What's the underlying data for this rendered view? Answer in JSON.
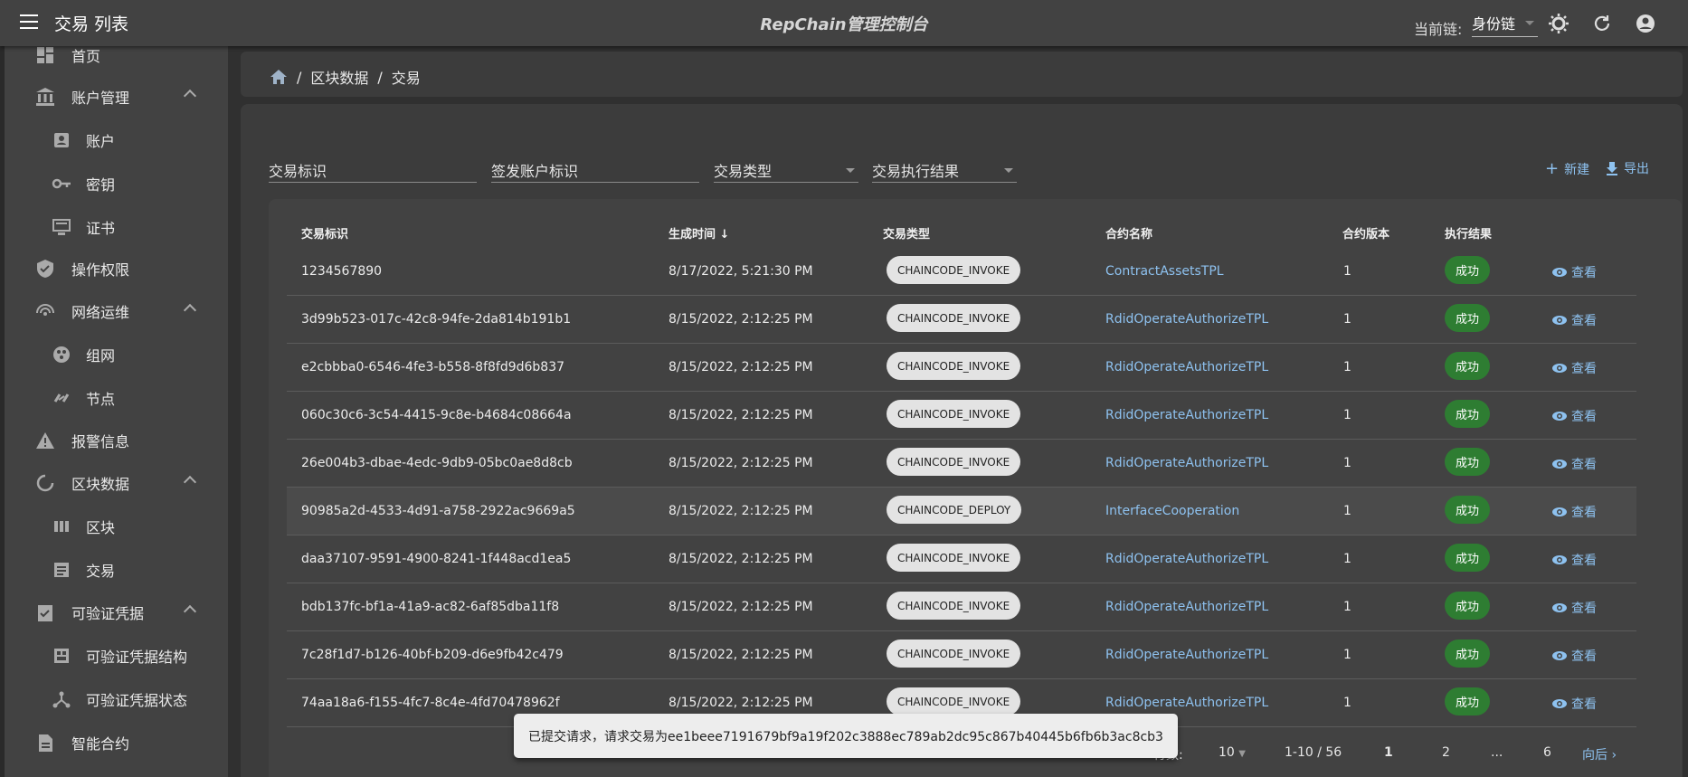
{
  "appbar": {
    "title": "交易 列表",
    "center_title": "RepChain管理控制台",
    "chain_label": "当前链:",
    "chain_value": "身份链"
  },
  "sidebar": {
    "items": [
      {
        "label": "首页",
        "icon": "dashboard-icon"
      },
      {
        "label": "账户管理",
        "icon": "bank-icon"
      },
      {
        "label": "账户",
        "icon": "account-box-icon"
      },
      {
        "label": "密钥",
        "icon": "key-icon"
      },
      {
        "label": "证书",
        "icon": "certificate-icon"
      },
      {
        "label": "操作权限",
        "icon": "shield-check-icon"
      },
      {
        "label": "网络运维",
        "icon": "wifi-icon"
      },
      {
        "label": "组网",
        "icon": "hub-icon"
      },
      {
        "label": "节点",
        "icon": "link-node-icon"
      },
      {
        "label": "报警信息",
        "icon": "warning-icon"
      },
      {
        "label": "区块数据",
        "icon": "loop-icon"
      },
      {
        "label": "区块",
        "icon": "blocks-icon"
      },
      {
        "label": "交易",
        "icon": "list-icon"
      },
      {
        "label": "可验证凭据",
        "icon": "clipboard-check-icon"
      },
      {
        "label": "可验证凭据结构",
        "icon": "schema-icon"
      },
      {
        "label": "可验证凭据状态",
        "icon": "tree-icon"
      },
      {
        "label": "智能合约",
        "icon": "document-icon"
      }
    ]
  },
  "breadcrumb": {
    "items": [
      "区块数据",
      "交易"
    ]
  },
  "filters": {
    "tx_id": "交易标识",
    "signer_id": "签发账户标识",
    "tx_type": "交易类型",
    "tx_result": "交易执行结果"
  },
  "actions": {
    "new_label": "新建",
    "export_label": "导出"
  },
  "table": {
    "headers": [
      "交易标识",
      "生成时间",
      "交易类型",
      "合约名称",
      "合约版本",
      "执行结果"
    ],
    "view_label": "查看",
    "rows": [
      {
        "id": "1234567890",
        "time": "8/17/2022, 5:21:30 PM",
        "type": "CHAINCODE_INVOKE",
        "contract": "ContractAssetsTPL",
        "version": "1",
        "result": "成功"
      },
      {
        "id": "3d99b523-017c-42c8-94fe-2da814b191b1",
        "time": "8/15/2022, 2:12:25 PM",
        "type": "CHAINCODE_INVOKE",
        "contract": "RdidOperateAuthorizeTPL",
        "version": "1",
        "result": "成功"
      },
      {
        "id": "e2cbbba0-6546-4fe3-b558-8f8fd9d6b837",
        "time": "8/15/2022, 2:12:25 PM",
        "type": "CHAINCODE_INVOKE",
        "contract": "RdidOperateAuthorizeTPL",
        "version": "1",
        "result": "成功"
      },
      {
        "id": "060c30c6-3c54-4415-9c8e-b4684c08664a",
        "time": "8/15/2022, 2:12:25 PM",
        "type": "CHAINCODE_INVOKE",
        "contract": "RdidOperateAuthorizeTPL",
        "version": "1",
        "result": "成功"
      },
      {
        "id": "26e004b3-dbae-4edc-9db9-05bc0ae8d8cb",
        "time": "8/15/2022, 2:12:25 PM",
        "type": "CHAINCODE_INVOKE",
        "contract": "RdidOperateAuthorizeTPL",
        "version": "1",
        "result": "成功"
      },
      {
        "id": "90985a2d-4533-4d91-a758-2922ac9669a5",
        "time": "8/15/2022, 2:12:25 PM",
        "type": "CHAINCODE_DEPLOY",
        "contract": "InterfaceCooperation",
        "version": "1",
        "result": "成功"
      },
      {
        "id": "daa37107-9591-4900-8241-1f448acd1ea5",
        "time": "8/15/2022, 2:12:25 PM",
        "type": "CHAINCODE_INVOKE",
        "contract": "RdidOperateAuthorizeTPL",
        "version": "1",
        "result": "成功"
      },
      {
        "id": "bdb137fc-bf1a-41a9-ac82-6af85dba11f8",
        "time": "8/15/2022, 2:12:25 PM",
        "type": "CHAINCODE_INVOKE",
        "contract": "RdidOperateAuthorizeTPL",
        "version": "1",
        "result": "成功"
      },
      {
        "id": "7c28f1d7-b126-40bf-b209-d6e9fb42c479",
        "time": "8/15/2022, 2:12:25 PM",
        "type": "CHAINCODE_INVOKE",
        "contract": "RdidOperateAuthorizeTPL",
        "version": "1",
        "result": "成功"
      },
      {
        "id": "74aa18a6-f155-4fc7-8c4e-4fd70478962f",
        "time": "8/15/2022, 2:12:25 PM",
        "type": "CHAINCODE_INVOKE",
        "contract": "RdidOperateAuthorizeTPL",
        "version": "1",
        "result": "成功"
      }
    ]
  },
  "pagination": {
    "rows_label": "行数:",
    "rows_value": "10",
    "range": "1-10 / 56",
    "pages": [
      "1",
      "2",
      "...",
      "6"
    ],
    "next_label": "向后"
  },
  "snackbar": {
    "message": "已提交请求，请求交易为ee1beee7191679bf9a19f202c3888ec789ab2dc95c867b40445b6fb6b3ac8cb3"
  },
  "colors": {
    "success": "#2e7d32",
    "link": "#8ec2f0",
    "appbar": "#424242",
    "background": "#303030"
  }
}
